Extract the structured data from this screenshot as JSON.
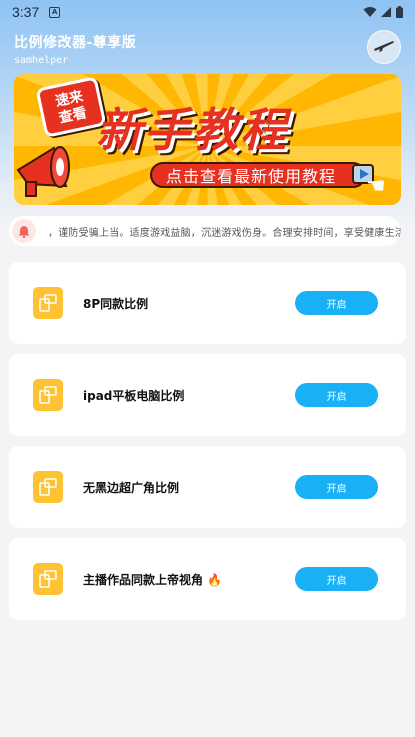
{
  "status_bar": {
    "time": "3:37",
    "icons": [
      "notification-a-icon",
      "wifi-icon",
      "signal-icon",
      "battery-icon"
    ]
  },
  "header": {
    "title": "比例修改器-尊享版",
    "subtitle": "samhelper",
    "avatar_icon": "rifle-icon"
  },
  "banner": {
    "badge_line1": "速来",
    "badge_line2": "查看",
    "headline": "新手教程",
    "pill_text": "点击查看最新使用教程",
    "accent_color": "#e63020",
    "bg_color": "#ffb703"
  },
  "notice": {
    "icon": "bell-icon",
    "text": "，谨防受骗上当。适度游戏益脑，沉迷游戏伤身。合理安排时间，享受健康生活。"
  },
  "options": [
    {
      "label": "8P同款比例",
      "button": "开启"
    },
    {
      "label": "ipad平板电脑比例",
      "button": "开启"
    },
    {
      "label": "无黑边超广角比例",
      "button": "开启"
    },
    {
      "label": "主播作品同款上帝视角 🔥",
      "button": "开启"
    }
  ],
  "colors": {
    "button_blue": "#19b0f6",
    "icon_yellow": "#ffc233"
  }
}
